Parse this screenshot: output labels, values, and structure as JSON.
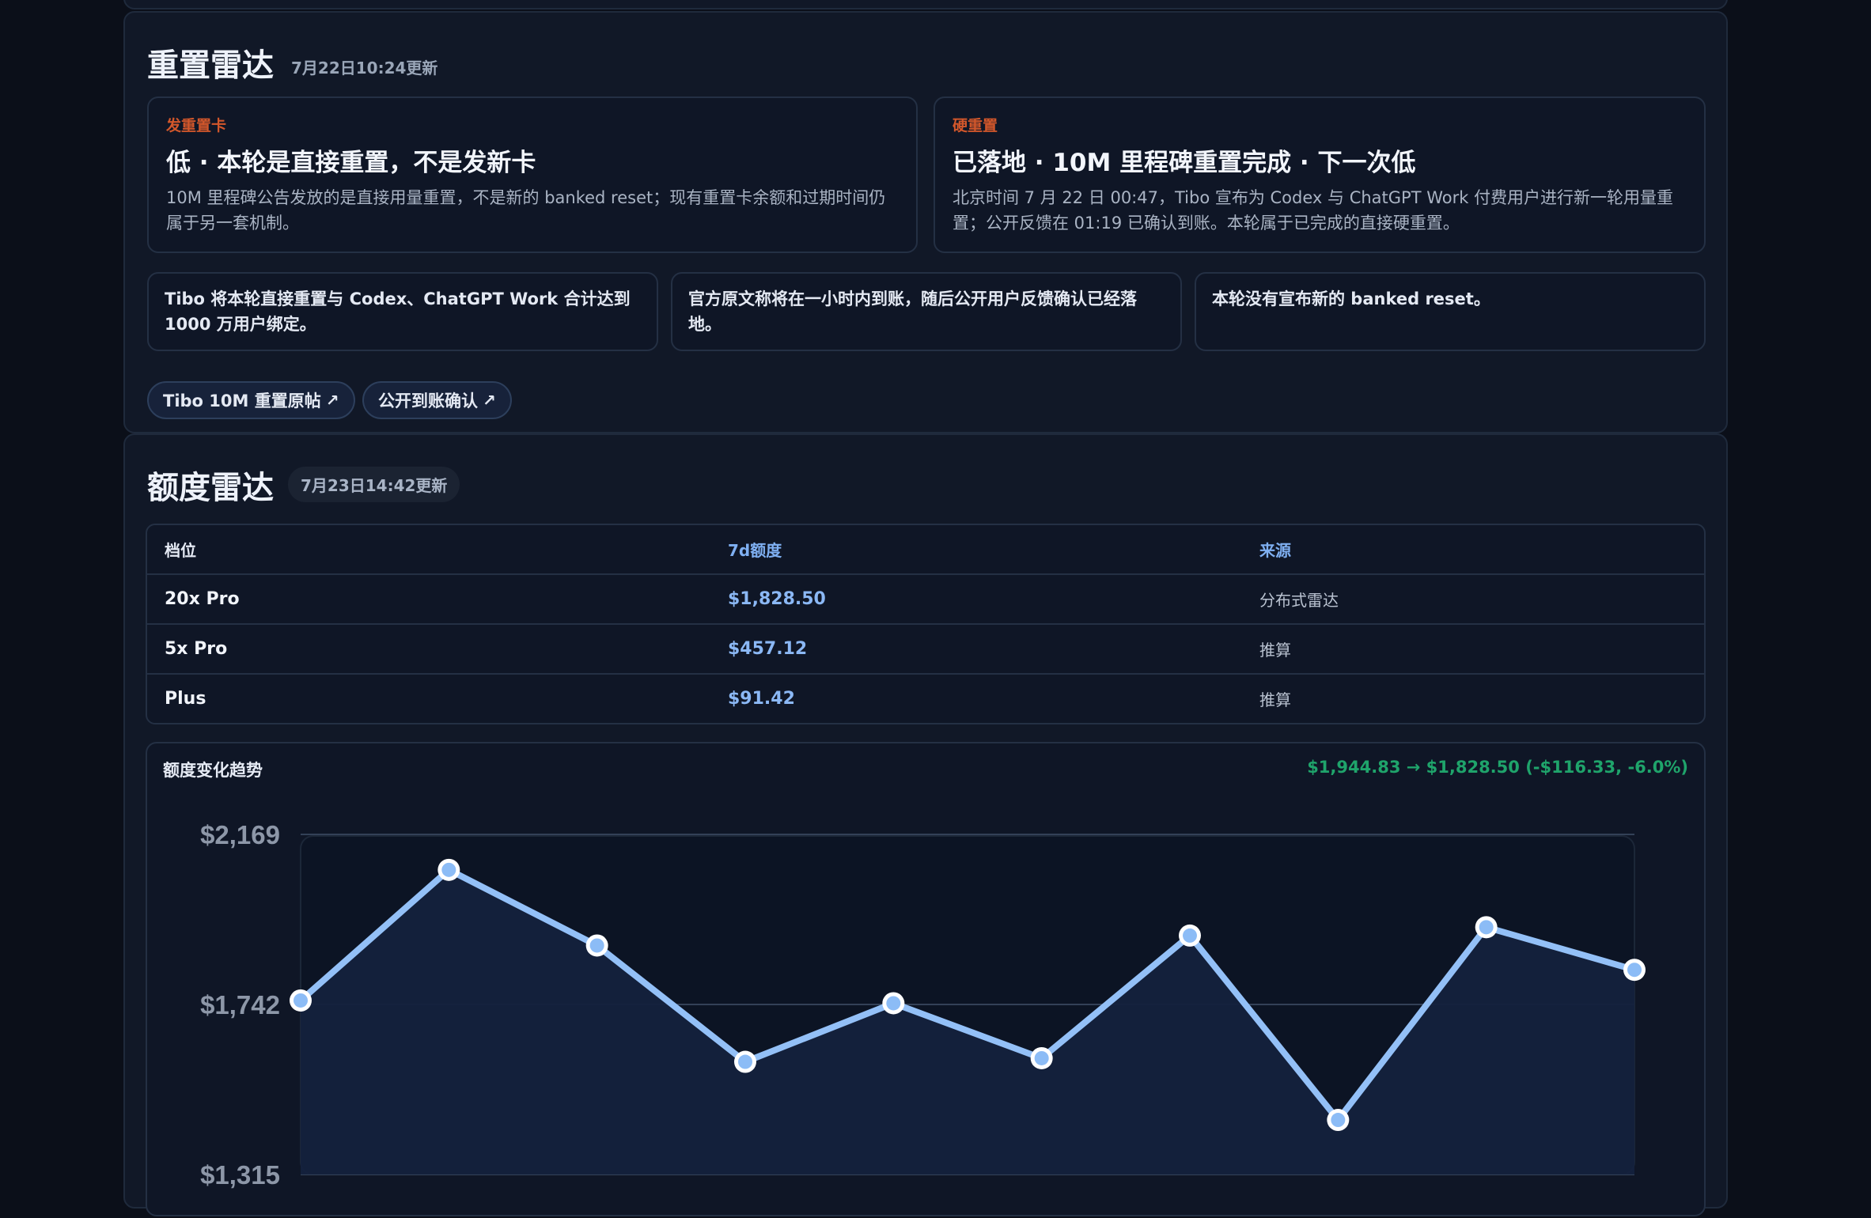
{
  "reset_radar": {
    "title": "重置雷达",
    "updated": "7月22日10:24更新",
    "cards": [
      {
        "kicker": "发重置卡",
        "headline": "低 · 本轮是直接重置，不是发新卡",
        "body": "10M 里程碑公告发放的是直接用量重置，不是新的 banked reset；现有重置卡余额和过期时间仍属于另一套机制。"
      },
      {
        "kicker": "硬重置",
        "headline": "已落地 · 10M 里程碑重置完成 · 下一次低",
        "body": "北京时间 7 月 22 日 00:47，Tibo 宣布为 Codex 与 ChatGPT Work 付费用户进行新一轮用量重置；公开反馈在 01:19 已确认到账。本轮属于已完成的直接硬重置。"
      }
    ],
    "notes": [
      "Tibo 将本轮直接重置与 Codex、ChatGPT Work 合计达到 1000 万用户绑定。",
      "官方原文称将在一小时内到账，随后公开用户反馈确认已经落地。",
      "本轮没有宣布新的 banked reset。"
    ],
    "links": [
      {
        "label": "Tibo 10M 重置原帖",
        "arrow": "↗"
      },
      {
        "label": "公开到账确认",
        "arrow": "↗"
      }
    ]
  },
  "quota_radar": {
    "title": "额度雷达",
    "updated": "7月23日14:42更新",
    "table": {
      "headers": [
        "档位",
        "7d额度",
        "来源"
      ],
      "rows": [
        [
          "20x Pro",
          "$1,828.50",
          "分布式雷达"
        ],
        [
          "5x Pro",
          "$457.12",
          "推算"
        ],
        [
          "Plus",
          "$91.42",
          "推算"
        ]
      ]
    },
    "chart_title": "额度变化趋势",
    "chart_delta": "$1,944.83 → $1,828.50 (-$116.33, -6.0%)"
  },
  "colors": {
    "accent_blue": "#8bb8f5",
    "kicker_orange": "#d2572b",
    "delta_green": "#1fa46b",
    "panel_bg": "#111827"
  },
  "chart_data": {
    "type": "line",
    "title": "额度变化趋势",
    "xlabel": "",
    "ylabel": "",
    "ylim": [
      1315,
      2169
    ],
    "yticks": [
      "$2,169",
      "$1,742",
      "$1,315"
    ],
    "ytick_values": [
      2169,
      1742,
      1315
    ],
    "grid": true,
    "series": [
      {
        "values": [
          1752,
          2080,
          1890,
          1598,
          1745,
          1607,
          1915,
          1452,
          1936,
          1829
        ]
      }
    ]
  }
}
